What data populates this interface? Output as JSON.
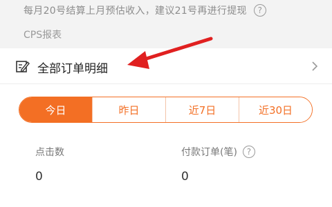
{
  "notice": {
    "text": "每月20号结算上月预估收入，建议21号再进行提现",
    "help_icon": "question-circle-icon"
  },
  "section": {
    "title": "CPS报表"
  },
  "orders_row": {
    "label": "全部订单明细",
    "icon": "edit-document-icon",
    "chevron": "chevron-right-icon"
  },
  "annotation": {
    "arrow_color": "#e02020"
  },
  "range_tabs": [
    {
      "label": "今日",
      "active": true
    },
    {
      "label": "昨日",
      "active": false
    },
    {
      "label": "近7日",
      "active": false
    },
    {
      "label": "近30日",
      "active": false
    }
  ],
  "stats": {
    "clicks": {
      "label": "点击数",
      "value": "0"
    },
    "paid_orders": {
      "label": "付款订单(笔)",
      "value": "0",
      "help_icon": "question-circle-icon"
    }
  },
  "colors": {
    "accent": "#f36f24",
    "background_gray": "#f3f3f3"
  }
}
